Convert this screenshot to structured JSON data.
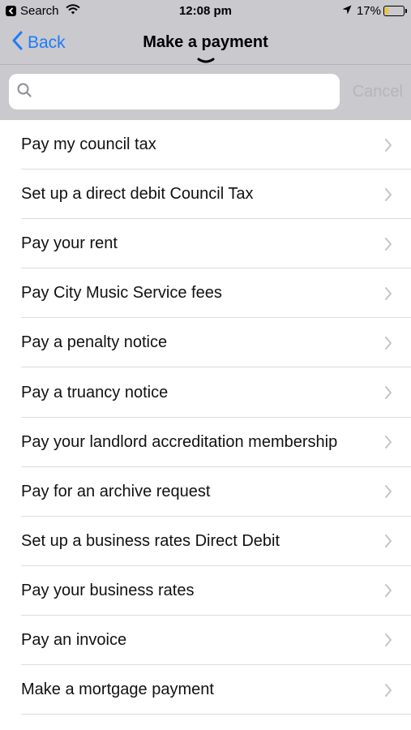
{
  "status_bar": {
    "back_app_label": "Search",
    "time": "12:08 pm",
    "battery_percent": "17%",
    "battery_level": 0.17,
    "icons": [
      "back-app-icon",
      "wifi-icon",
      "location-arrow-icon",
      "battery-icon"
    ]
  },
  "nav": {
    "back_label": "Back",
    "title": "Make a payment"
  },
  "search": {
    "placeholder": "",
    "value": "",
    "cancel_label": "Cancel"
  },
  "colors": {
    "accent": "#1f7bf6",
    "bar_background": "#c9c9ce",
    "battery": "#f4c430",
    "cancel_disabled": "#b5b5ba"
  },
  "items": [
    {
      "label": "Pay my council tax"
    },
    {
      "label": "Set up a direct debit Council Tax"
    },
    {
      "label": "Pay your rent"
    },
    {
      "label": "Pay City Music Service fees"
    },
    {
      "label": "Pay a penalty notice"
    },
    {
      "label": "Pay a truancy notice"
    },
    {
      "label": "Pay your landlord accreditation membership"
    },
    {
      "label": "Pay for an archive request"
    },
    {
      "label": "Set up a business rates Direct Debit"
    },
    {
      "label": "Pay your business rates"
    },
    {
      "label": "Pay an invoice"
    },
    {
      "label": "Make a mortgage payment"
    }
  ]
}
